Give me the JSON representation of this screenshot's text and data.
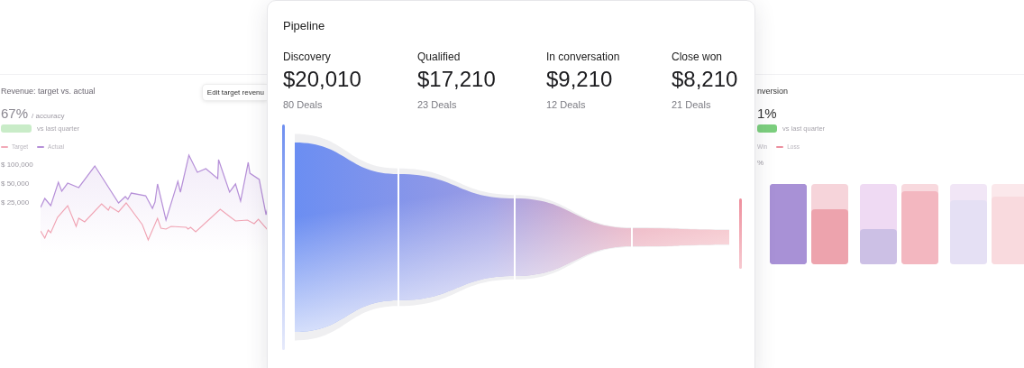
{
  "revenue_card": {
    "title": "Revenue: target vs. actual",
    "edit_button": "Edit target revenu",
    "value": "67%",
    "value_caption": "/ accuracy",
    "comparison": "vs last quarter",
    "legend": [
      {
        "label": "Target",
        "color": "#f2a9b8"
      },
      {
        "label": "Actual",
        "color": "#b690d8"
      }
    ],
    "y_axis_labels": [
      "$ 100,000",
      "$ 50,000",
      "$ 25,000"
    ]
  },
  "pipeline": {
    "title": "Pipeline",
    "stages": [
      {
        "label": "Discovery",
        "amount": "$20,010",
        "deals": "80 Deals"
      },
      {
        "label": "Qualified",
        "amount": "$17,210",
        "deals": "23 Deals"
      },
      {
        "label": "In conversation",
        "amount": "$9,210",
        "deals": "12 Deals"
      },
      {
        "label": "Close won",
        "amount": "$8,210",
        "deals": "21 Deals"
      }
    ]
  },
  "conversion_card": {
    "title": "nversion",
    "value": "1%",
    "comparison": "vs last quarter",
    "legend": [
      {
        "label": "Win"
      },
      {
        "label": "Loss",
        "color": "#ec8f9f"
      }
    ],
    "y_axis_label": "%"
  }
}
